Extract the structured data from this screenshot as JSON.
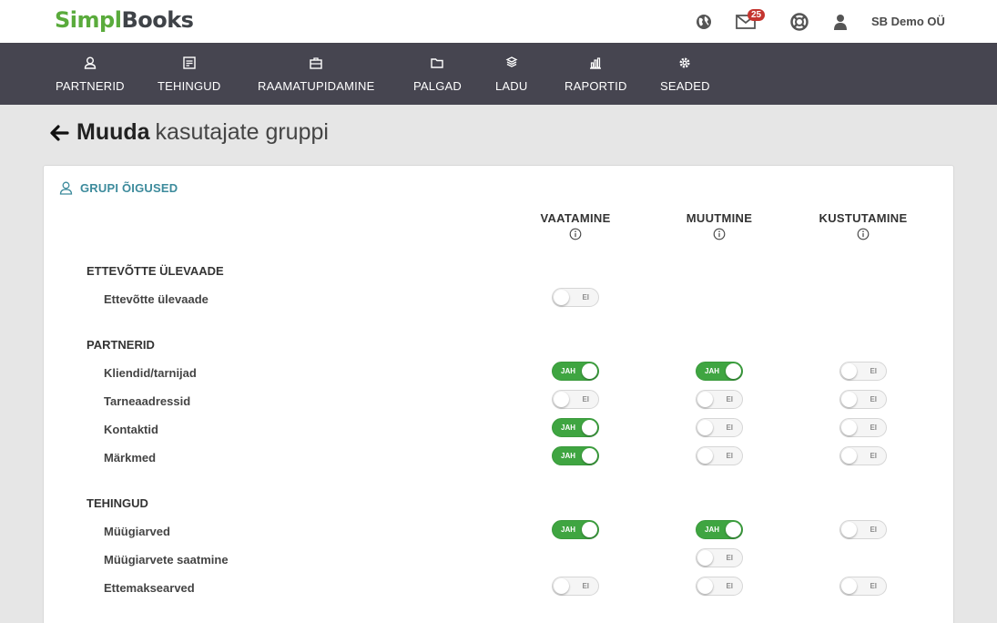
{
  "brand": {
    "part1": "Simpl",
    "part2": "Books"
  },
  "top": {
    "mail_badge": "25",
    "company": "SB Demo OÜ"
  },
  "nav": [
    {
      "label": "PARTNERID",
      "icon": "user-icon"
    },
    {
      "label": "TEHINGUD",
      "icon": "invoice-icon"
    },
    {
      "label": "RAAMATUPIDAMINE",
      "icon": "briefcase-icon"
    },
    {
      "label": "PALGAD",
      "icon": "folder-icon"
    },
    {
      "label": "LADU",
      "icon": "boxes-icon"
    },
    {
      "label": "RAPORTID",
      "icon": "bar-chart-icon"
    },
    {
      "label": "SEADED",
      "icon": "gear-icon"
    }
  ],
  "page": {
    "title_bold": "Muuda",
    "title_rest": "kasutajate gruppi"
  },
  "card": {
    "header": "GRUPI ÕIGUSED",
    "columns": [
      "VAATAMINE",
      "MUUTMINE",
      "KUSTUTAMINE"
    ],
    "toggle_on": "JAH",
    "toggle_off": "EI",
    "sections": [
      {
        "title": "ETTEVÕTTE ÜLEVAADE",
        "rows": [
          {
            "label": "Ettevõtte ülevaade",
            "perms": [
              false,
              null,
              null
            ]
          }
        ]
      },
      {
        "title": "PARTNERID",
        "rows": [
          {
            "label": "Kliendid/tarnijad",
            "perms": [
              true,
              true,
              false
            ]
          },
          {
            "label": "Tarneaadressid",
            "perms": [
              false,
              false,
              false
            ]
          },
          {
            "label": "Kontaktid",
            "perms": [
              true,
              false,
              false
            ]
          },
          {
            "label": "Märkmed",
            "perms": [
              true,
              false,
              false
            ]
          }
        ]
      },
      {
        "title": "TEHINGUD",
        "rows": [
          {
            "label": "Müügiarved",
            "perms": [
              true,
              true,
              false
            ]
          },
          {
            "label": "Müügiarvete saatmine",
            "perms": [
              null,
              false,
              null
            ]
          },
          {
            "label": "Ettemaksearved",
            "perms": [
              false,
              false,
              false
            ]
          }
        ]
      }
    ]
  }
}
